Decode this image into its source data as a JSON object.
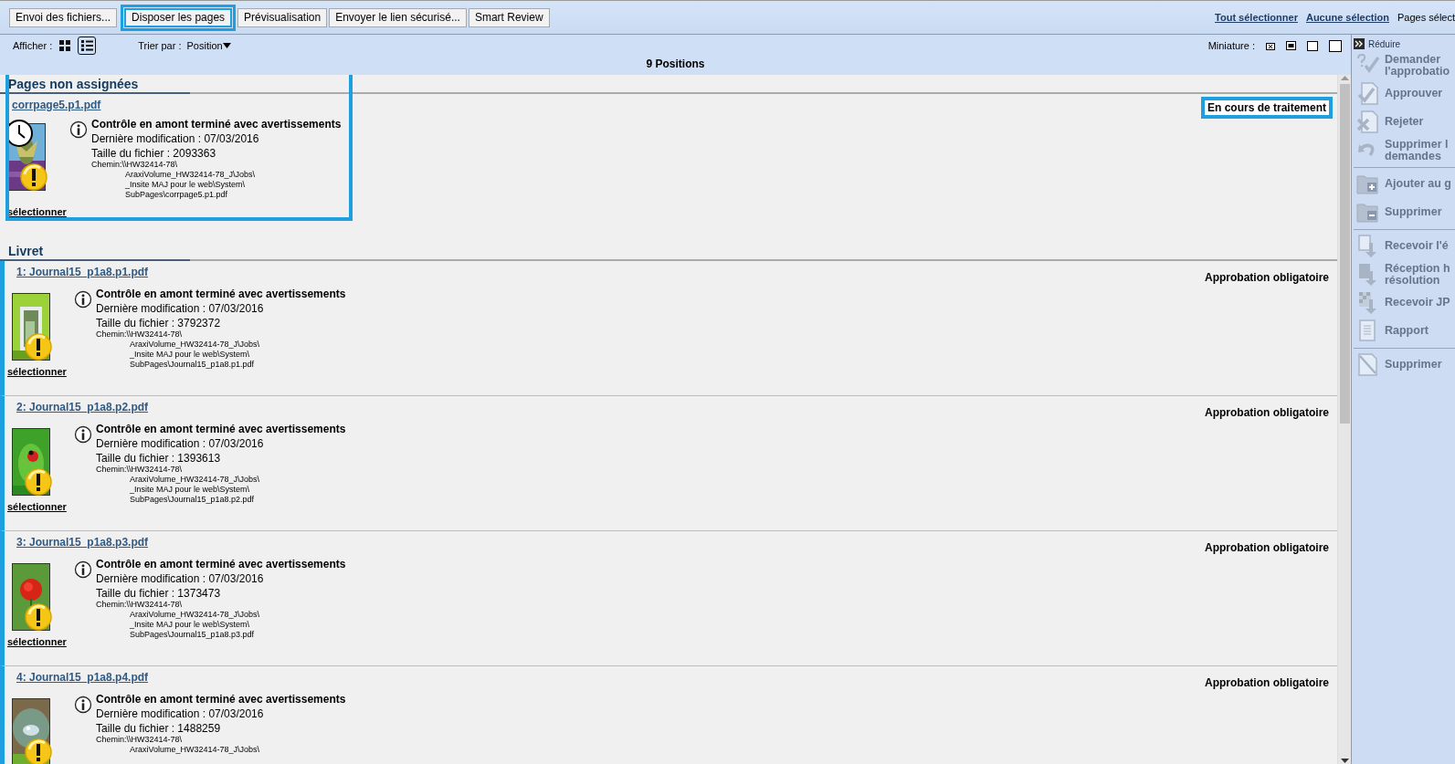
{
  "toolbar": {
    "buttons": [
      {
        "label": "Envoi des fichiers...",
        "highlighted": false
      },
      {
        "label": "Disposer les pages",
        "highlighted": true
      },
      {
        "label": "Prévisualisation",
        "highlighted": false
      },
      {
        "label": "Envoyer le lien sécurisé...",
        "highlighted": false
      },
      {
        "label": "Smart Review",
        "highlighted": false
      }
    ],
    "links": [
      {
        "label": "Tout sélectionner",
        "kind": "link"
      },
      {
        "label": "Aucune sélection",
        "kind": "link"
      },
      {
        "label": "Pages sélect",
        "kind": "text"
      }
    ]
  },
  "list_header": {
    "view_label": "Afficher :",
    "view_modes": [
      {
        "kind": "grid",
        "selected": false
      },
      {
        "kind": "list",
        "selected": true
      }
    ],
    "sort_label": "Trier par :",
    "sort_value": "Position",
    "thumbnail_label": "Miniature :",
    "thumbnail_sizes": [
      {
        "kind": "tiny"
      },
      {
        "kind": "small"
      },
      {
        "kind": "medium"
      },
      {
        "kind": "large"
      }
    ],
    "count": "9 Positions"
  },
  "sections": [
    {
      "title": "Pages non assignées",
      "kind": "unassigned",
      "highlighted": true,
      "items": [
        {
          "name": "corrpage5.p1.pdf",
          "status": "En cours de traitement",
          "status_highlighted": true,
          "processing": true,
          "warning": true,
          "preflight": "Contrôle en amont terminé avec avertissements",
          "modified": "Dernière modification : 07/03/2016",
          "size": "Taille du fichier : 2093363",
          "path": [
            "Chemin:\\\\HW32414-78\\",
            "AraxiVolume_HW32414-78_J\\Jobs\\",
            "_Insite MAJ pour le web\\System\\",
            "SubPages\\corrpage5.p1.pdf"
          ],
          "select": "sélectionner"
        }
      ]
    },
    {
      "title": "Livret",
      "kind": "booklet",
      "highlighted": false,
      "items": [
        {
          "name": "1: Journal15_p1a8.p1.pdf",
          "status": "Approbation obligatoire",
          "status_highlighted": false,
          "processing": false,
          "warning": true,
          "preflight": "Contrôle en amont terminé avec avertissements",
          "modified": "Dernière modification : 07/03/2016",
          "size": "Taille du fichier : 3792372",
          "path": [
            "Chemin:\\\\HW32414-78\\",
            "AraxiVolume_HW32414-78_J\\Jobs\\",
            "_Insite MAJ pour le web\\System\\",
            "SubPages\\Journal15_p1a8.p1.pdf"
          ],
          "select": "sélectionner"
        },
        {
          "name": "2: Journal15_p1a8.p2.pdf",
          "status": "Approbation obligatoire",
          "status_highlighted": false,
          "processing": false,
          "warning": true,
          "preflight": "Contrôle en amont terminé avec avertissements",
          "modified": "Dernière modification : 07/03/2016",
          "size": "Taille du fichier : 1393613",
          "path": [
            "Chemin:\\\\HW32414-78\\",
            "AraxiVolume_HW32414-78_J\\Jobs\\",
            "_Insite MAJ pour le web\\System\\",
            "SubPages\\Journal15_p1a8.p2.pdf"
          ],
          "select": "sélectionner"
        },
        {
          "name": "3: Journal15_p1a8.p3.pdf",
          "status": "Approbation obligatoire",
          "status_highlighted": false,
          "processing": false,
          "warning": true,
          "preflight": "Contrôle en amont terminé avec avertissements",
          "modified": "Dernière modification : 07/03/2016",
          "size": "Taille du fichier : 1373473",
          "path": [
            "Chemin:\\\\HW32414-78\\",
            "AraxiVolume_HW32414-78_J\\Jobs\\",
            "_Insite MAJ pour le web\\System\\",
            "SubPages\\Journal15_p1a8.p3.pdf"
          ],
          "select": "sélectionner"
        },
        {
          "name": "4: Journal15_p1a8.p4.pdf",
          "status": "Approbation obligatoire",
          "status_highlighted": false,
          "processing": false,
          "warning": true,
          "preflight": "Contrôle en amont terminé avec avertissements",
          "modified": "Dernière modification : 07/03/2016",
          "size": "Taille du fichier : 1488259",
          "path": [
            "Chemin:\\\\HW32414-78\\",
            "AraxiVolume_HW32414-78_J\\Jobs\\"
          ]
        }
      ]
    }
  ],
  "side_panel": {
    "collapse_label": "Réduire",
    "groups": [
      {
        "items": [
          {
            "kind": "request",
            "label": "Demander l'approbatio",
            "disabled": true
          },
          {
            "kind": "approve",
            "label": "Approuver",
            "disabled": true
          },
          {
            "kind": "reject",
            "label": "Rejeter",
            "disabled": true
          },
          {
            "kind": "undo",
            "label": "Supprimer l\ndemandes",
            "disabled": true
          }
        ]
      },
      {
        "items": [
          {
            "kind": "folder-add",
            "label": "Ajouter au g",
            "disabled": true
          },
          {
            "kind": "folder-remove",
            "label": "Supprimer",
            "disabled": true
          }
        ]
      },
      {
        "items": [
          {
            "kind": "download",
            "label": "Recevoir l'é",
            "disabled": true
          },
          {
            "kind": "download-hires",
            "label": "Réception h\nrésolution",
            "disabled": true
          },
          {
            "kind": "download-grid",
            "label": "Recevoir JP",
            "disabled": true
          },
          {
            "kind": "report",
            "label": "Rapport",
            "disabled": true
          }
        ]
      },
      {
        "items": [
          {
            "kind": "delete",
            "label": "Supprimer",
            "disabled": true
          }
        ]
      }
    ]
  }
}
